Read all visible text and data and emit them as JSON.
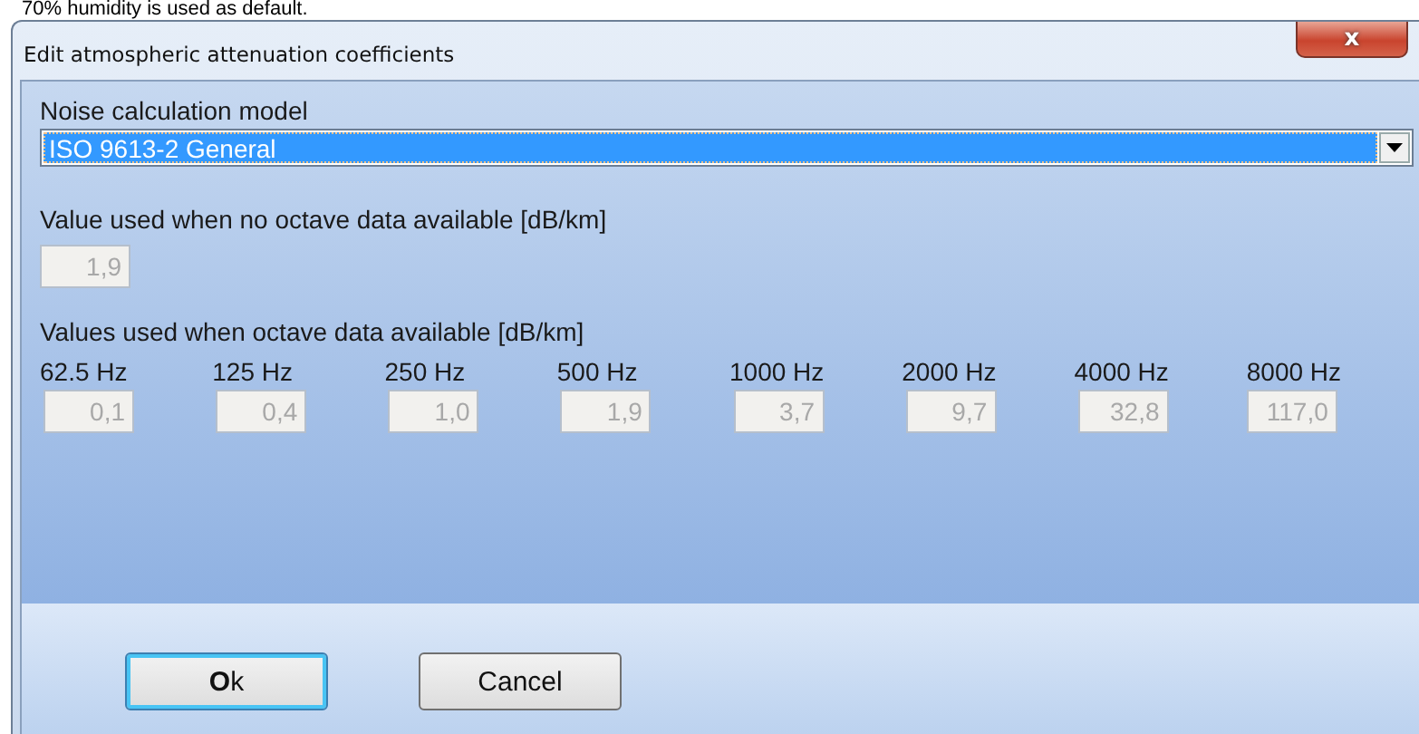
{
  "background_text": "70% humidity is used as default.",
  "window": {
    "title": "Edit atmospheric attenuation coefficients",
    "close": "x"
  },
  "model": {
    "label": "Noise calculation model",
    "value": "ISO 9613-2 General",
    "focused": true
  },
  "single": {
    "label": "Value used when no octave data available [dB/km]",
    "value": "1,9",
    "disabled": true
  },
  "octave": {
    "label": "Values used when octave data available  [dB/km]",
    "bands": [
      {
        "label": "62.5 Hz",
        "value": "0,1",
        "disabled": true
      },
      {
        "label": "125 Hz",
        "value": "0,4",
        "disabled": true
      },
      {
        "label": "250 Hz",
        "value": "1,0",
        "disabled": true
      },
      {
        "label": "500 Hz",
        "value": "1,9",
        "disabled": true
      },
      {
        "label": "1000 Hz",
        "value": "3,7",
        "disabled": true
      },
      {
        "label": "2000 Hz",
        "value": "9,7",
        "disabled": true
      },
      {
        "label": "4000 Hz",
        "value": "32,8",
        "disabled": true
      },
      {
        "label": "8000 Hz",
        "value": "117,0",
        "disabled": true
      }
    ]
  },
  "buttons": [
    {
      "label": "**O**k",
      "focused": true
    },
    {
      "label": "Cancel",
      "focused": false
    }
  ]
}
